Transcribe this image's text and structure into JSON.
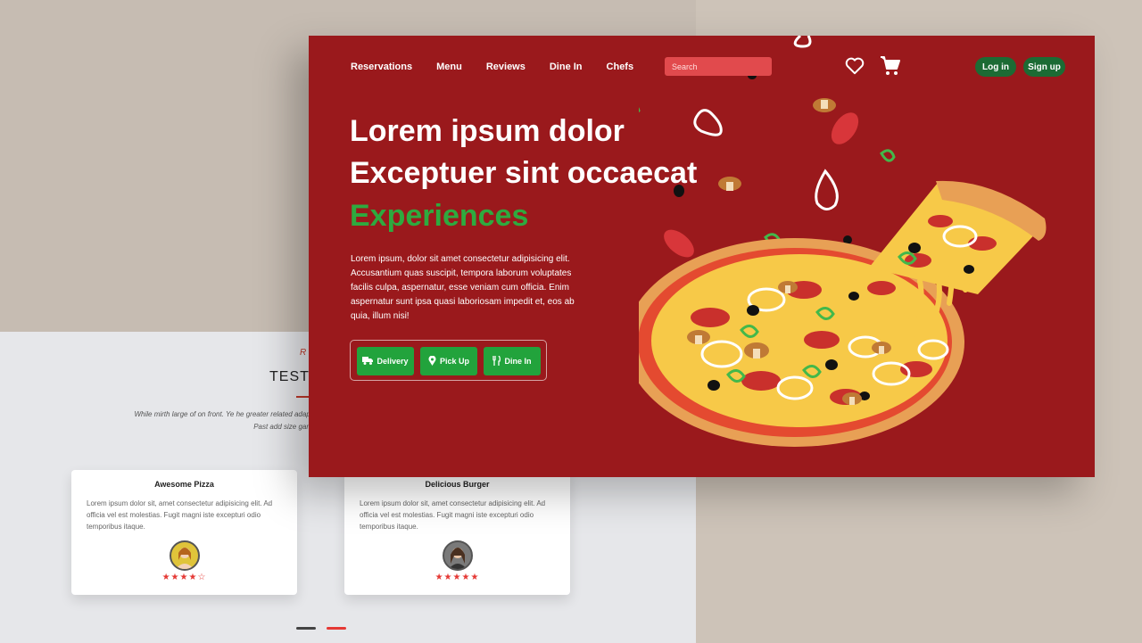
{
  "background_section": {
    "subtitle": "R",
    "title": "TESTIM",
    "description": "While mirth large of on front. Ye he greater related adapt Past add size gam",
    "cards": [
      {
        "title": "Awesome Pizza",
        "text": "Lorem ipsum dolor sit, amet consectetur adipisicing elit. Ad officia vel est molestias. Fugit magni iste excepturi odio temporibus itaque.",
        "rating_stars": "★★★★☆"
      },
      {
        "title": "Delicious Burger",
        "text": "Lorem ipsum dolor sit, amet consectetur adipisicing elit. Ad officia vel est molestias. Fugit magni iste excepturi odio temporibus itaque.",
        "rating_stars": "★★★★★"
      }
    ]
  },
  "nav": {
    "items": [
      "Reservations",
      "Menu",
      "Reviews",
      "Dine In",
      "Chefs"
    ],
    "search_placeholder": "Search",
    "login_label": "Log in",
    "signup_label": "Sign up"
  },
  "hero": {
    "line1": "Lorem ipsum dolor",
    "line2": "Exceptuer sint occaecat",
    "line3": "Experiences",
    "paragraph": "Lorem ipsum, dolor sit amet consectetur adipisicing elit. Accusantium quas suscipit, tempora laborum voluptates facilis culpa, aspernatur, esse veniam cum officia. Enim aspernatur sunt ipsa quasi laboriosam impedit et, eos ab quia, illum nisi!",
    "buttons": {
      "delivery": "Delivery",
      "pickup": "Pick Up",
      "dinein": "Dine In"
    }
  },
  "icons": {
    "heart": "heart-icon",
    "cart": "cart-icon",
    "truck": "truck-icon",
    "pin": "map-pin-icon",
    "utensils": "utensils-icon"
  },
  "colors": {
    "hero_bg": "#9a191c",
    "accent_green": "#22a33c",
    "auth_green": "#1c6b34",
    "heading_green": "#2eaa3f",
    "search_bg": "#e14a4d",
    "star_red": "#e53935"
  }
}
